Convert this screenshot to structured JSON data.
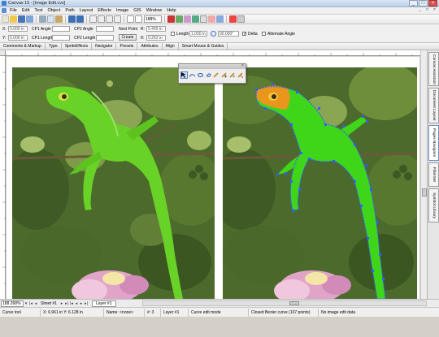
{
  "window": {
    "title": "Canvas 15 - [Image Edit.cvx]",
    "buttons": [
      "_",
      "□",
      "×"
    ]
  },
  "menu": {
    "items": [
      "File",
      "Edit",
      "Text",
      "Object",
      "Path",
      "Layout",
      "Effects",
      "Image",
      "GIS",
      "Window",
      "Help"
    ],
    "mdi_buttons": [
      "_",
      "□",
      "×"
    ]
  },
  "toolbar": {
    "zoom_value": "188%"
  },
  "properties": {
    "x_label": "X:",
    "x_value": "0.000 in",
    "y_label": "Y:",
    "y_value": "0.000 in",
    "cp1_angle_label": "CP1 Angle",
    "cp2_angle_label": "CP2 Angle",
    "cp1_length_label": "CP1 Length",
    "cp2_length_label": "CP2 Length",
    "next_point_label": "Next Point",
    "create_label": "Create",
    "r_label": "R:",
    "r_value": "5.455 in",
    "theta_label": "θ:",
    "theta_value": "0.252 in",
    "length_label": "Length",
    "length_value": "1.000 in",
    "angle_value": "90.000°",
    "delta_label": "Delta",
    "alternate_angle_label": "Alternate Angle"
  },
  "panel_tabs": [
    "Comments & Markup",
    "Type",
    "SpriteEffects",
    "Navigator",
    "Presets",
    "Attributes",
    "Align",
    "Smart Mouse & Guides"
  ],
  "docker_tabs": [
    "Canvas Assistant",
    "Document Layout",
    "Pages Navigator",
    "FilterSet",
    "Symbol Library"
  ],
  "bottom": {
    "zoom": "188.268%",
    "sheet": "Sheet #1",
    "layer": "Layer #1"
  },
  "status": {
    "tool": "Curve tool",
    "coords": "X: 6.961 in   Y: 6.128 in",
    "name": "Name: <none>",
    "count": "#: 3",
    "layer": "Layer #1",
    "mode": "Curve edit mode",
    "info": "Closed Bezier curve (107 points)",
    "image_edit": "No image edit data"
  },
  "colors": {
    "accent": "#3a7fd1",
    "selection": "#2f5fff",
    "lizard": "#5fd21c"
  }
}
